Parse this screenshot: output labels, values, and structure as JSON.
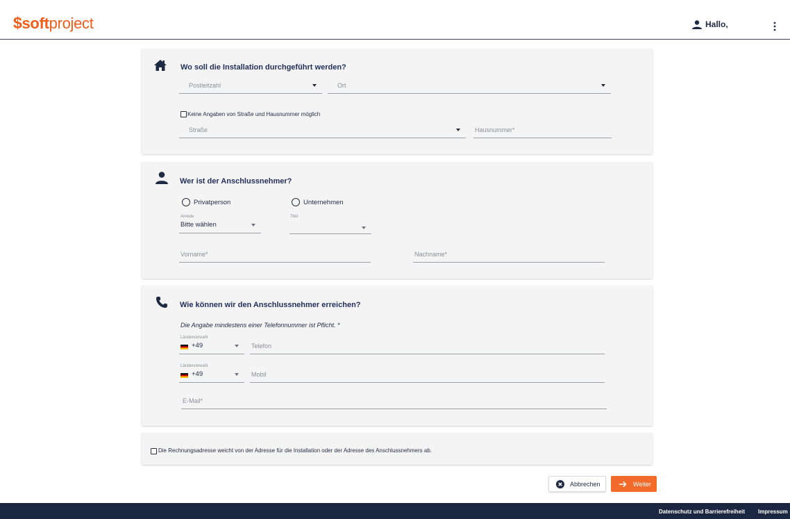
{
  "header": {
    "logo_prefix": "soft",
    "logo_suffix": "project",
    "greeting": "Hallo,",
    "icons": [
      "person-icon",
      "kebab-menu-icon"
    ]
  },
  "installation": {
    "title": "Wo soll die Installation durchgeführt werden?",
    "icon": "home-icon",
    "postcode_placeholder": "Postleitzahl",
    "city_placeholder": "Ort",
    "no_street_checkbox": "Keine Angaben von Straße und Hausnummer möglich",
    "street_placeholder": "Straße",
    "house_number_placeholder": "Hausnummer*"
  },
  "customer": {
    "title": "Wer ist der Anschlussnehmer?",
    "icon": "person-icon",
    "radio_private": "Privatperson",
    "radio_company": "Unternehmen",
    "salutation_label": "Anrede",
    "salutation_value": "Bitte wählen",
    "title_label": "Titel",
    "firstname_placeholder": "Vorname*",
    "lastname_placeholder": "Nachname*"
  },
  "contact": {
    "title": "Wie können wir den Anschlussnehmer erreichen?",
    "icon": "phone-icon",
    "note": "Die Angabe mindestens einer Telefonnummer ist Pflicht. *",
    "country_code_label": "Ländervorwahl",
    "phone_code": "+49",
    "phone_placeholder": "Telefon",
    "mobile_code": "+49",
    "mobile_placeholder": "Mobil",
    "email_placeholder": "E-Mail*"
  },
  "billing": {
    "checkbox_label": "Die Rechnungsadresse weicht von der Adresse für die Installation oder der Adresse des Anschlussnehmers ab."
  },
  "actions": {
    "cancel_label": "Abbrechen",
    "next_label": "Weiter"
  },
  "footer": {
    "privacy_link": "Datenschutz und Barrierefreiheit",
    "imprint_link": "Impressum"
  },
  "colors": {
    "brand_orange": "#f26b2a",
    "navy": "#1b2740",
    "card_bg": "#f4f4f4"
  }
}
